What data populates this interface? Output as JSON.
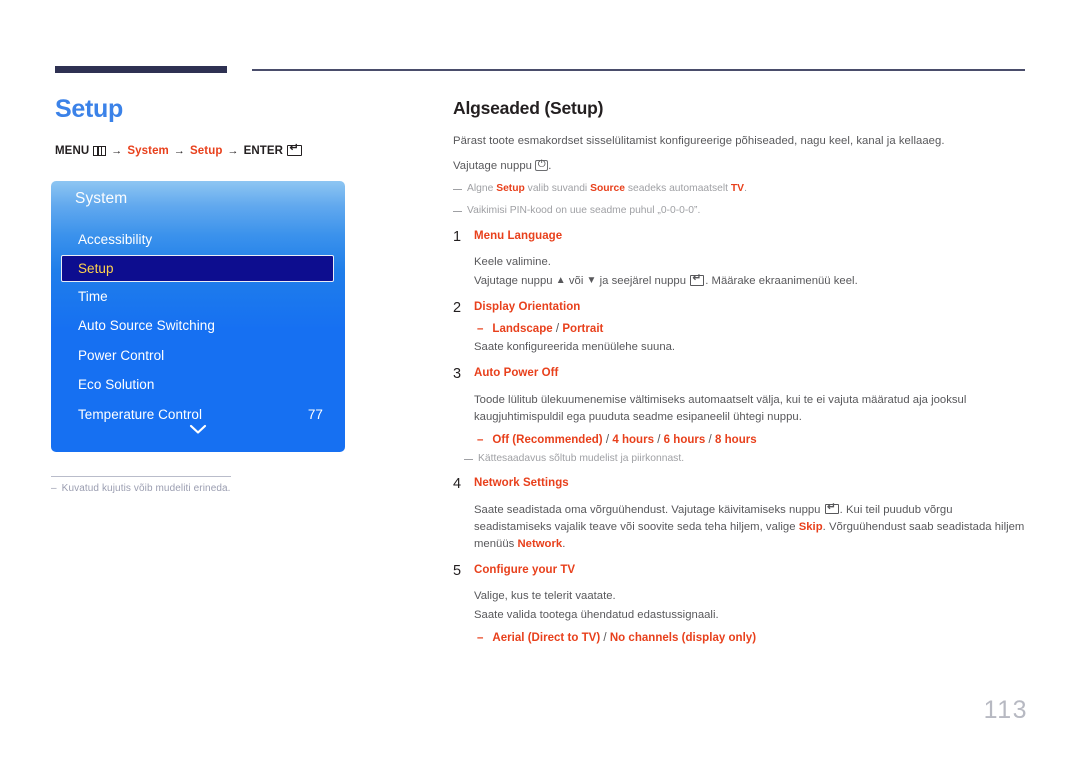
{
  "header": {
    "page_title": "Setup",
    "breadcrumb": {
      "menu_label": "MENU",
      "menu_icon": "menu-grid-icon",
      "arrow": "→",
      "item1": "System",
      "item2": "Setup",
      "enter_label": "ENTER",
      "enter_icon": "enter-return-icon"
    }
  },
  "osd": {
    "title": "System",
    "items": [
      {
        "label": "Accessibility",
        "value": "",
        "selected": false
      },
      {
        "label": "Setup",
        "value": "",
        "selected": true
      },
      {
        "label": "Time",
        "value": "",
        "selected": false
      },
      {
        "label": "Auto Source Switching",
        "value": "",
        "selected": false
      },
      {
        "label": "Power Control",
        "value": "",
        "selected": false
      },
      {
        "label": "Eco Solution",
        "value": "",
        "selected": false
      },
      {
        "label": "Temperature Control",
        "value": "77",
        "selected": false
      }
    ],
    "scroll_icon": "chevron-down-icon"
  },
  "left_footnote": {
    "dash": "–",
    "text": "Kuvatud kujutis võib mudeliti erineda."
  },
  "main": {
    "section_title": "Algseaded (Setup)",
    "intro": "Pärast toote esmakordset sisselülitamist konfigureerige põhiseaded, nagu keel, kanal ja kellaaeg.",
    "press_button_pre": "Vajutage nuppu",
    "press_button_post": ".",
    "power_icon": "power-button-icon",
    "notes": [
      {
        "parts": [
          {
            "t": "Algne ",
            "style": "plain"
          },
          {
            "t": "Setup",
            "style": "red"
          },
          {
            "t": " valib suvandi ",
            "style": "plain"
          },
          {
            "t": "Source",
            "style": "red"
          },
          {
            "t": " seadeks automaatselt ",
            "style": "plain"
          },
          {
            "t": "TV",
            "style": "red"
          },
          {
            "t": ".",
            "style": "plain"
          }
        ]
      },
      {
        "parts": [
          {
            "t": "Vaikimisi PIN-kood on uue seadme puhul „0-0-0-0”.",
            "style": "plain"
          }
        ]
      }
    ],
    "steps": [
      {
        "num": "1",
        "head": "Menu Language",
        "lines": [
          "Keele valimine.",
          "Vajutage nuppu ▲ või ▼ ja seejärel nuppu ENTER. Määrake ekraanimenüü keel."
        ],
        "line2_pre": "Vajutage nuppu",
        "line2_mid": "või",
        "line2_mid2": "ja seejärel nuppu",
        "line2_post": ". Määrake ekraanimenüü keel.",
        "up_arrow": "▲",
        "down_arrow": "▼",
        "options": "",
        "note": ""
      },
      {
        "num": "2",
        "head": "Display Orientation",
        "option_dash": "–",
        "options": "Landscape / Portrait",
        "option_parts": [
          "Landscape",
          " / ",
          "Portrait"
        ],
        "after_text": "Saate konfigureerida menüülehe suuna."
      },
      {
        "num": "3",
        "head": "Auto Power Off",
        "body": "Toode lülitub ülekuumenemise vältimiseks automaatselt välja, kui te ei vajuta määratud aja jooksul kaugjuhtimispuldil ega puuduta seadme esipaneelil ühtegi nuppu.",
        "option_dash": "–",
        "option_parts": [
          "Off (Recommended)",
          " / ",
          "4 hours",
          " / ",
          "6 hours",
          " / ",
          "8 hours"
        ],
        "note": "Kättesaadavus sõltub mudelist ja piirkonnast."
      },
      {
        "num": "4",
        "head": "Network Settings",
        "body_pre": "Saate seadistada oma võrguühendust. Vajutage käivitamiseks nuppu",
        "body_mid": ". Kui teil puudub võrgu seadistamiseks vajalik teave või soovite seda teha hiljem, valige ",
        "skip": "Skip",
        "body_mid2": ". Võrguühendust saab seadistada hiljem menüüs ",
        "network": "Network",
        "body_post": "."
      },
      {
        "num": "5",
        "head": "Configure your TV",
        "lines": [
          "Valige, kus te telerit vaatate.",
          "Saate valida tootega ühendatud edastussignaali."
        ],
        "option_dash": "–",
        "option_parts": [
          "Aerial (Direct to TV)",
          " / ",
          "No channels (display only)"
        ]
      }
    ]
  },
  "page_number": "113",
  "colors": {
    "accent_blue": "#3b82e8",
    "accent_red": "#e8401c",
    "rule_navy": "#2e3152",
    "osd_blue": "#1670f2",
    "osd_selected": "#0d0d8f",
    "osd_selected_text": "#ffd34d",
    "body_gray": "#58585b",
    "note_gray": "#9fa0a4",
    "page_num_gray": "#b7b9c2"
  }
}
